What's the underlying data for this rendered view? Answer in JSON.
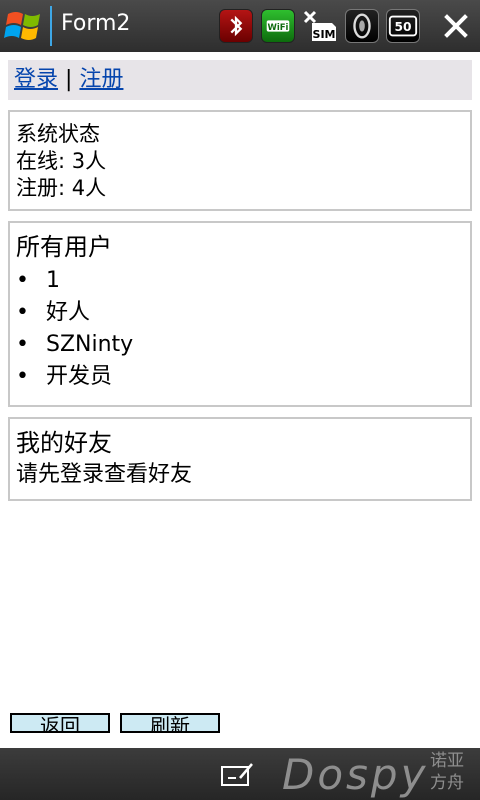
{
  "titlebar": {
    "app_title": "Form2",
    "battery_text": "50",
    "icons": [
      "windows-start-icon",
      "bluetooth-icon",
      "wifi-icon",
      "no-sim-icon",
      "volume-icon",
      "battery-icon",
      "close-icon"
    ]
  },
  "nav": {
    "login": "登录",
    "separator": "|",
    "register": "注册"
  },
  "status_panel": {
    "title": "系统状态",
    "online": "在线: 3人",
    "registered": "注册: 4人"
  },
  "users_panel": {
    "title": "所有用户",
    "bullet": "•",
    "users": [
      "1",
      "好人",
      "SZNinty",
      "开发员"
    ]
  },
  "friends_panel": {
    "title": "我的好友",
    "message": "请先登录查看好友"
  },
  "buttons": {
    "back": "返回",
    "refresh": "刷新"
  },
  "bottombar": {
    "watermark": "Dospy",
    "watermark_cn_line1": "诺亚",
    "watermark_cn_line2": "方舟"
  },
  "colors": {
    "link": "#0645ad",
    "titlebar": "#2e2e2e",
    "button_bg": "#cdeaf3",
    "panel_border": "#c8c8c8"
  }
}
